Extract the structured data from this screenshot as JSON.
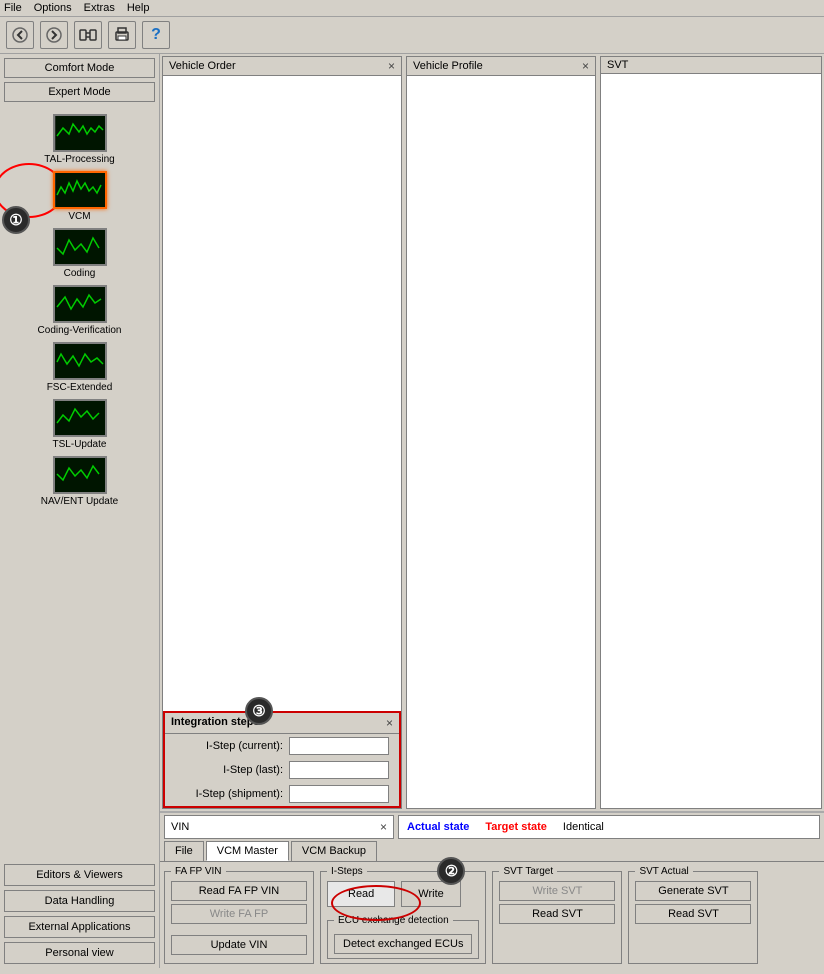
{
  "menu": {
    "items": [
      "File",
      "Options",
      "Extras",
      "Help"
    ]
  },
  "toolbar": {
    "back_btn": "◀",
    "forward_btn": "▶",
    "connect_btn": "⇄",
    "print_btn": "🖨",
    "help_btn": "?"
  },
  "sidebar": {
    "comfort_mode": "Comfort Mode",
    "expert_mode": "Expert Mode",
    "items": [
      {
        "label": "TAL-Processing",
        "selected": false
      },
      {
        "label": "VCM",
        "selected": true
      },
      {
        "label": "Coding",
        "selected": false
      },
      {
        "label": "Coding-Verification",
        "selected": false
      },
      {
        "label": "FSC-Extended",
        "selected": false
      },
      {
        "label": "TSL-Update",
        "selected": false
      },
      {
        "label": "NAV/ENT Update",
        "selected": false
      }
    ],
    "bottom_buttons": [
      {
        "label": "Editors & Viewers",
        "active": false
      },
      {
        "label": "Data Handling",
        "active": false
      },
      {
        "label": "External Applications",
        "active": false
      },
      {
        "label": "Personal view",
        "active": false
      }
    ]
  },
  "panels": {
    "vehicle_order": {
      "title": "Vehicle Order",
      "close": "×"
    },
    "vehicle_profile": {
      "title": "Vehicle Profile",
      "close": "×"
    },
    "svt": {
      "title": "SVT"
    }
  },
  "status": {
    "actual": "Actual state",
    "target": "Target state",
    "identical": "Identical"
  },
  "vin_panel": {
    "title": "VIN",
    "close": "×"
  },
  "tabs": {
    "items": [
      "File",
      "VCM Master",
      "VCM Backup"
    ]
  },
  "fa_fp_section": {
    "label": "FA FP VIN",
    "read_fa_fp_vin": "Read FA FP VIN",
    "write_fa_fp": "Write FA FP",
    "update_vin": "Update VIN"
  },
  "isteps_section": {
    "label": "I-Steps",
    "read": "Read",
    "write": "Write"
  },
  "integration_steps": {
    "title": "Integration steps",
    "close": "×",
    "current_label": "I-Step (current):",
    "last_label": "I-Step (last):",
    "shipment_label": "I-Step (shipment):",
    "current_value": "",
    "last_value": "",
    "shipment_value": ""
  },
  "ecu_exchange": {
    "label": "ECU exchange detection",
    "detect_btn": "Detect exchanged ECUs"
  },
  "svt_target": {
    "label": "SVT Target",
    "write_svt": "Write SVT",
    "read_svt": "Read SVT"
  },
  "svt_actual": {
    "label": "SVT Actual",
    "generate_svt": "Generate SVT",
    "read_svt": "Read SVT"
  },
  "badges": {
    "one": "①",
    "two": "②",
    "three": "③"
  },
  "colors": {
    "accent_red": "#cc0000",
    "accent_blue": "#0000cc",
    "status_actual": "#0000cc",
    "status_target": "#cc0000",
    "bg": "#d4d0c8",
    "selected_orange": "#ff6600"
  }
}
